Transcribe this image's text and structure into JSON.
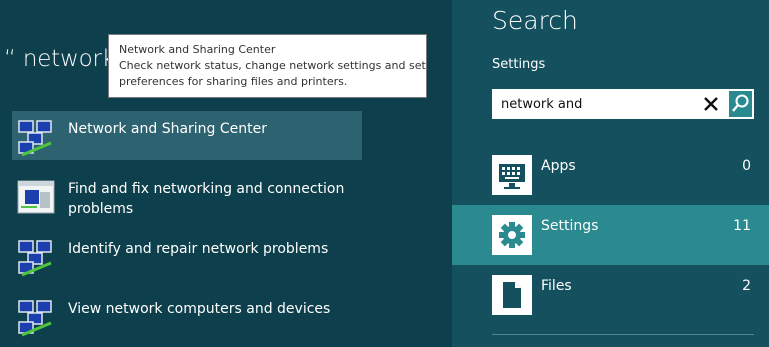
{
  "results": {
    "query_heading": "“ network",
    "items": [
      {
        "label": "Network and Sharing Center",
        "icon": "network-monitors-icon",
        "selected": true
      },
      {
        "label": "Find and fix networking and connection problems",
        "icon": "troubleshoot-window-icon",
        "selected": false
      },
      {
        "label": "Identify and repair network problems",
        "icon": "network-monitors-icon",
        "selected": false
      },
      {
        "label": "View network computers and devices",
        "icon": "network-monitors-icon",
        "selected": false
      }
    ]
  },
  "tooltip": {
    "title": "Network and Sharing Center",
    "line1": "Check network status, change network settings and set",
    "line2": "preferences for sharing files and printers."
  },
  "search": {
    "title": "Search",
    "scope_label": "Settings",
    "input_value": "network and",
    "categories": [
      {
        "label": "Apps",
        "count": "0",
        "icon": "keyboard-monitor-icon",
        "active": false
      },
      {
        "label": "Settings",
        "count": "11",
        "icon": "gear-icon",
        "active": true
      },
      {
        "label": "Files",
        "count": "2",
        "icon": "file-icon",
        "active": false
      }
    ]
  },
  "colors": {
    "results_bg": "#0e3f4c",
    "search_bg": "#15505e",
    "accent": "#2a8a8f",
    "selected_result": "#2d6270"
  }
}
